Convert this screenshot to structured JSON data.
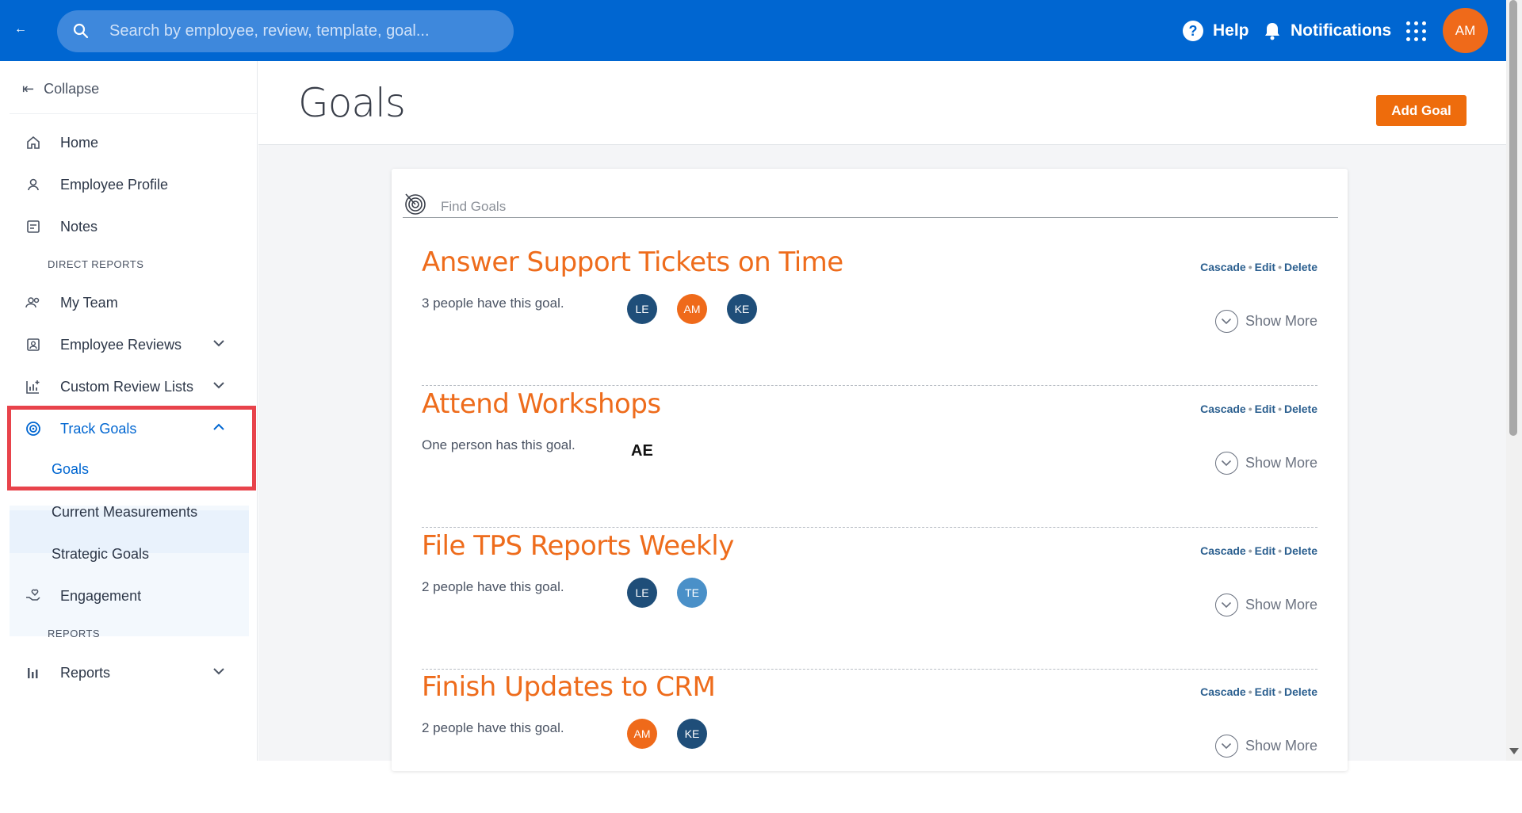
{
  "topbar": {
    "back_label": "←",
    "search_placeholder": "Search by employee, review, template, goal...",
    "help_label": "Help",
    "notifications_label": "Notifications",
    "user_initials": "AM"
  },
  "sidebar": {
    "collapse_label": "Collapse",
    "home": "Home",
    "employee_profile": "Employee Profile",
    "notes": "Notes",
    "section_direct_reports": "DIRECT REPORTS",
    "my_team": "My Team",
    "employee_reviews": "Employee Reviews",
    "custom_review_lists": "Custom Review Lists",
    "track_goals": "Track Goals",
    "goals": "Goals",
    "current_measurements": "Current Measurements",
    "strategic_goals": "Strategic Goals",
    "engagement": "Engagement",
    "section_reports": "REPORTS",
    "reports": "Reports"
  },
  "main": {
    "page_title": "Goals",
    "add_goal_label": "Add Goal",
    "find_placeholder": "Find Goals",
    "actions": {
      "cascade": "Cascade",
      "edit": "Edit",
      "delete": "Delete",
      "sep": "•"
    },
    "show_more": "Show More",
    "goals": [
      {
        "title": "Answer Support Tickets on Time",
        "count_text": "3 people have this goal.",
        "avatars": [
          "LE",
          "AM",
          "KE"
        ]
      },
      {
        "title": "Attend Workshops",
        "count_text": "One person has this goal.",
        "avatars": [
          "AE"
        ]
      },
      {
        "title": "File TPS Reports Weekly",
        "count_text": "2 people have this goal.",
        "avatars": [
          "LE",
          "TE"
        ]
      },
      {
        "title": "Finish Updates to CRM",
        "count_text": "2 people have this goal.",
        "avatars": [
          "AM",
          "KE"
        ]
      }
    ]
  },
  "colors": {
    "topbar": "#0066d1",
    "accent_orange": "#ee6c0c",
    "avatar_navy": "#1f4e79",
    "avatar_orange": "#ef6a1a",
    "avatar_light_blue": "#4a90c8",
    "highlight_red": "#e8434b"
  }
}
